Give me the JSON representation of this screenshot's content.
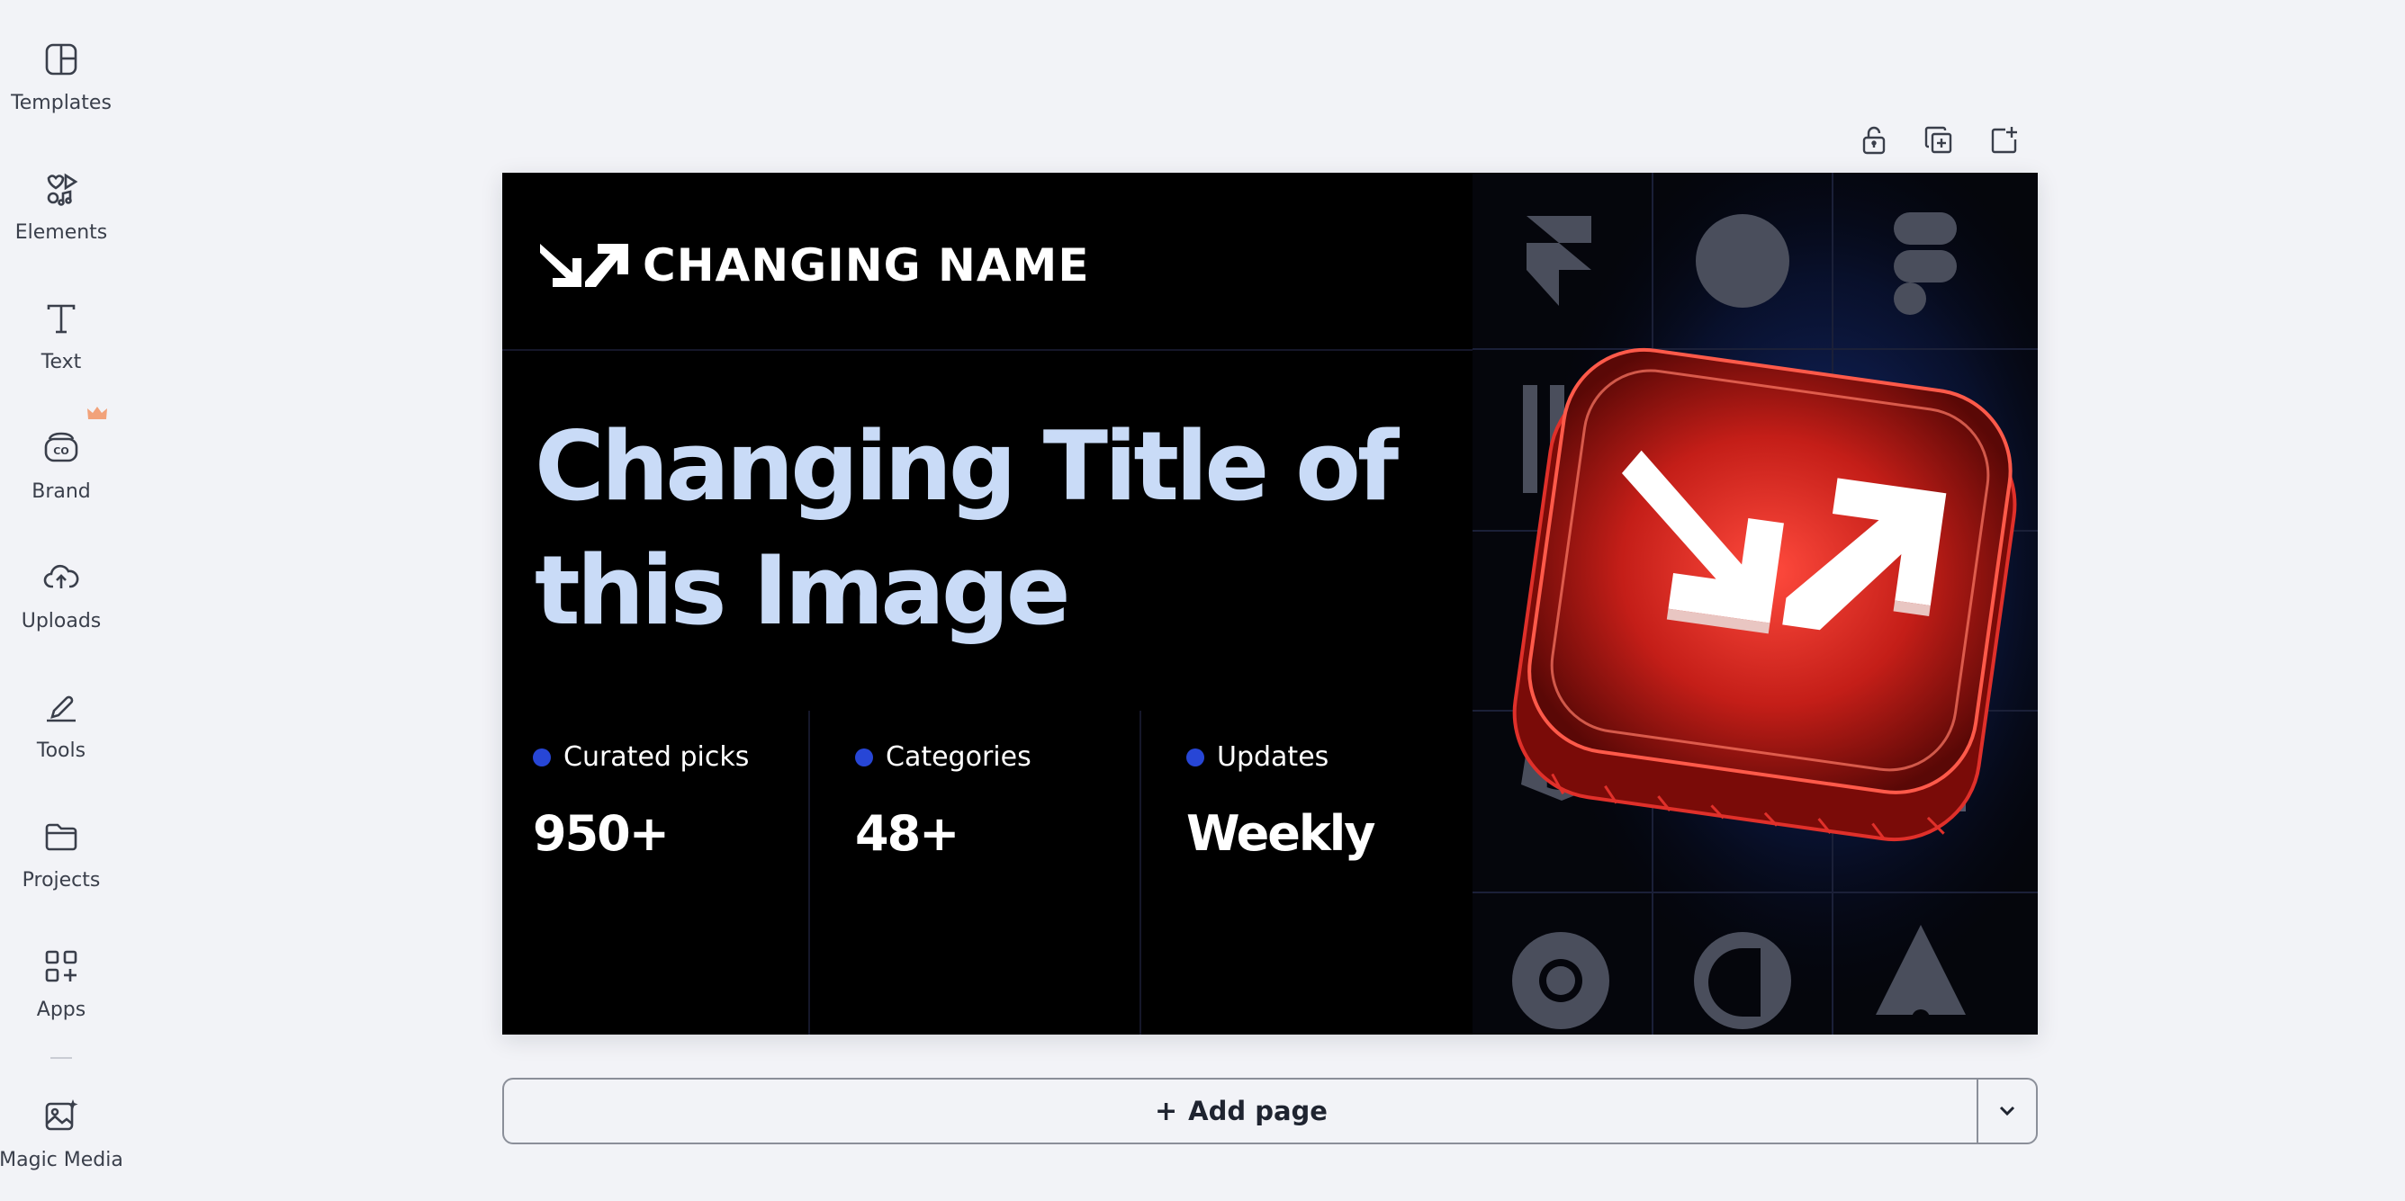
{
  "sidebar": {
    "items": [
      {
        "label": "Templates",
        "icon": "templates-icon"
      },
      {
        "label": "Elements",
        "icon": "elements-icon"
      },
      {
        "label": "Text",
        "icon": "text-icon"
      },
      {
        "label": "Brand",
        "icon": "brand-icon"
      },
      {
        "label": "Uploads",
        "icon": "uploads-icon"
      },
      {
        "label": "Tools",
        "icon": "tools-icon"
      },
      {
        "label": "Projects",
        "icon": "projects-icon"
      },
      {
        "label": "Apps",
        "icon": "apps-icon"
      },
      {
        "label": "Magic Media",
        "icon": "magic-media-icon"
      }
    ]
  },
  "page_tools": [
    "lock-icon",
    "duplicate-page-icon",
    "add-page-icon"
  ],
  "design": {
    "brand_name": "CHANGING NAME",
    "headline_line1": "Changing Title of",
    "headline_line2": "this Image",
    "stats": [
      {
        "label": "Curated picks",
        "value": "950+"
      },
      {
        "label": "Categories",
        "value": "48+"
      },
      {
        "label": "Updates",
        "value": "Weekly"
      }
    ],
    "colors": {
      "background": "#000000",
      "headline": "#c9dbf7",
      "accent_dot": "#2746d6",
      "app_icon_red": "#d8251f"
    }
  },
  "add_page": {
    "plus": "+",
    "label": "Add page"
  },
  "colors": {
    "app_background": "#f2f3f7",
    "sidebar_text": "#3a3f4b"
  }
}
